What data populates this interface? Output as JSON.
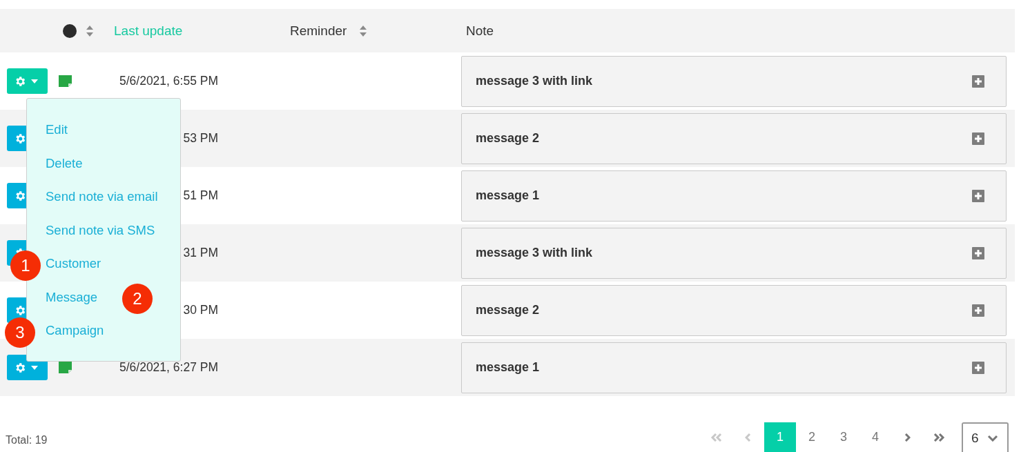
{
  "table": {
    "columns": [
      {
        "kind": "status",
        "sortable": true
      },
      {
        "kind": "text",
        "label": "Last update",
        "active": true,
        "sortable": false
      },
      {
        "kind": "text",
        "label": "Reminder",
        "active": false,
        "sortable": true
      },
      {
        "kind": "text",
        "label": "Note",
        "active": false,
        "sortable": false
      }
    ],
    "rows": [
      {
        "menu_open": true,
        "note_icon": true,
        "last_update": "5/6/2021, 6:55 PM",
        "note": "message 3 with link"
      },
      {
        "menu_open": false,
        "note_icon": false,
        "last_update": "53 PM",
        "note": "message 2"
      },
      {
        "menu_open": false,
        "note_icon": false,
        "last_update": "51 PM",
        "note": "message 1"
      },
      {
        "menu_open": false,
        "note_icon": false,
        "last_update": "31 PM",
        "note": "message 3 with link"
      },
      {
        "menu_open": false,
        "note_icon": false,
        "last_update": "30 PM",
        "note": "message 2"
      },
      {
        "menu_open": false,
        "note_icon": true,
        "last_update": "5/6/2021, 6:27 PM",
        "note": "message 1"
      }
    ]
  },
  "menu": {
    "items": [
      "Edit",
      "Delete",
      "Send note via email",
      "Send note via SMS",
      "Customer",
      "Message",
      "Campaign"
    ]
  },
  "annotations": [
    {
      "label": "1"
    },
    {
      "label": "2"
    },
    {
      "label": "3"
    }
  ],
  "footer": {
    "total": "Total: 19",
    "nav_start": [
      {
        "kind": "first",
        "disabled": true
      },
      {
        "kind": "prev",
        "disabled": true
      }
    ],
    "pages": [
      {
        "label": "1",
        "selected": true
      },
      {
        "label": "2",
        "selected": false
      },
      {
        "label": "3",
        "selected": false
      },
      {
        "label": "4",
        "selected": false
      }
    ],
    "nav_end": [
      {
        "kind": "next",
        "disabled": false
      },
      {
        "kind": "last",
        "disabled": false
      }
    ],
    "page_size": "6"
  }
}
